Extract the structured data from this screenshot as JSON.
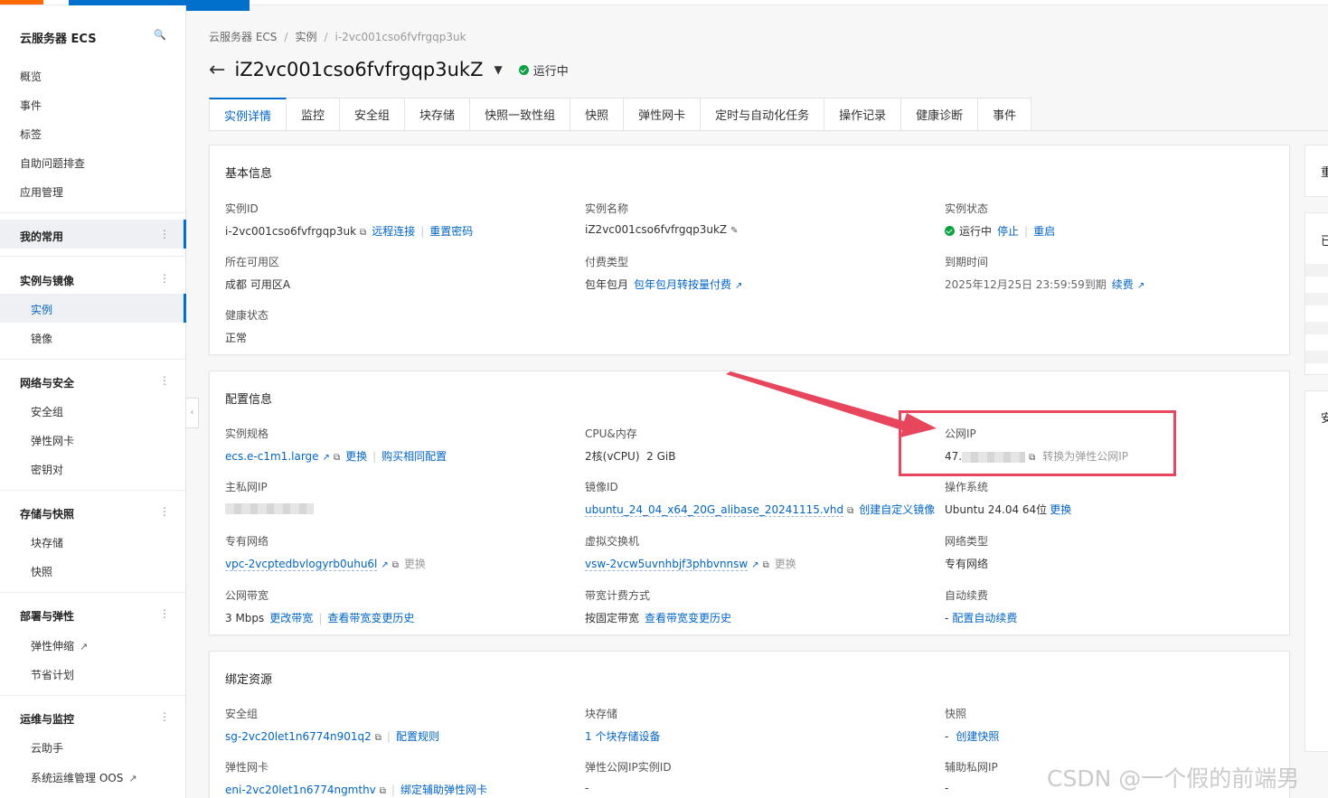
{
  "sidebar": {
    "title": "云服务器 ECS",
    "top_items": [
      "概览",
      "事件",
      "标签",
      "自助问题排查",
      "应用管理"
    ],
    "favorites": "我的常用",
    "groups": [
      {
        "label": "实例与镜像",
        "items": [
          "实例",
          "镜像"
        ]
      },
      {
        "label": "网络与安全",
        "items": [
          "安全组",
          "弹性网卡",
          "密钥对"
        ]
      },
      {
        "label": "存储与快照",
        "items": [
          "块存储",
          "快照"
        ]
      },
      {
        "label": "部署与弹性",
        "items": [
          "弹性伸缩",
          "节省计划"
        ]
      },
      {
        "label": "运维与监控",
        "items": [
          "云助手",
          "系统运维管理 OOS"
        ]
      }
    ]
  },
  "breadcrumb": [
    "云服务器 ECS",
    "实例",
    "i-2vc001cso6fvfrgqp3uk"
  ],
  "header": {
    "title": "iZ2vc001cso6fvfrgqp3ukZ",
    "status": "运行中"
  },
  "tabs": [
    "实例详情",
    "监控",
    "安全组",
    "块存储",
    "快照一致性组",
    "快照",
    "弹性网卡",
    "定时与自动化任务",
    "操作记录",
    "健康诊断",
    "事件"
  ],
  "basic": {
    "title": "基本信息",
    "instance_id_label": "实例ID",
    "instance_id": "i-2vc001cso6fvfrgqp3uk",
    "remote_connect": "远程连接",
    "reset_password": "重置密码",
    "name_label": "实例名称",
    "name": "iZ2vc001cso6fvfrgqp3ukZ",
    "state_label": "实例状态",
    "state": "运行中",
    "stop": "停止",
    "restart": "重启",
    "zone_label": "所在可用区",
    "zone": "成都 可用区A",
    "billing_label": "付费类型",
    "billing": "包年包月",
    "billing_convert": "包年包月转按量付费",
    "expire_label": "到期时间",
    "expire": "2025年12月25日 23:59:59到期",
    "renew": "续费",
    "health_label": "健康状态",
    "health": "正常"
  },
  "config": {
    "title": "配置信息",
    "spec_label": "实例规格",
    "spec": "ecs.e-c1m1.large",
    "spec_change": "更换",
    "spec_buy": "购买相同配置",
    "cpu_label": "CPU&内存",
    "cpu": "2核(vCPU)",
    "mem": "2 GiB",
    "public_ip_label": "公网IP",
    "public_ip_prefix": "47.",
    "public_ip_convert": "转换为弹性公网IP",
    "private_ip_label": "主私网IP",
    "image_label": "镜像ID",
    "image": "ubuntu_24_04_x64_20G_alibase_20241115.vhd",
    "image_create": "创建自定义镜像",
    "os_label": "操作系统",
    "os": "Ubuntu 24.04 64位",
    "os_change": "更换",
    "vpc_label": "专有网络",
    "vpc": "vpc-2vcptedbvlogyrb0uhu6l",
    "vpc_change": "更换",
    "vsw_label": "虚拟交换机",
    "vsw": "vsw-2vcw5uvnhbjf3phbvnnsw",
    "vsw_change": "更换",
    "net_type_label": "网络类型",
    "net_type": "专有网络",
    "bw_label": "公网带宽",
    "bw": "3 Mbps",
    "bw_change": "更改带宽",
    "bw_history": "查看带宽变更历史",
    "bw_billing_label": "带宽计费方式",
    "bw_billing": "按固定带宽",
    "bw_billing_history": "查看带宽变更历史",
    "auto_renew_label": "自动续费",
    "auto_renew_dash": "-",
    "auto_renew_config": "配置自动续费"
  },
  "bind": {
    "title": "绑定资源",
    "sg_label": "安全组",
    "sg": "sg-2vc20let1n6774n901q2",
    "sg_rules": "配置规则",
    "disk_label": "块存储",
    "disk": "1 个块存储设备",
    "snap_label": "快照",
    "snap_dash": "-",
    "snap_create": "创建快照",
    "eni_label": "弹性网卡",
    "eni": "eni-2vc20let1n6774ngmthv",
    "eni_bind": "绑定辅助弹性网卡",
    "eip_label": "弹性公网IP实例ID",
    "eip": "-",
    "sec_ip_label": "辅助私网IP",
    "sec_ip": "-"
  },
  "right_panel": {
    "t1": "重",
    "t2": "已",
    "t3": "安"
  },
  "watermark": "CSDN @一个假的前端男",
  "colors": {
    "primary": "#0064c8",
    "accent": "#0070cc",
    "running": "#06a43e",
    "annotation": "#e8465c"
  }
}
